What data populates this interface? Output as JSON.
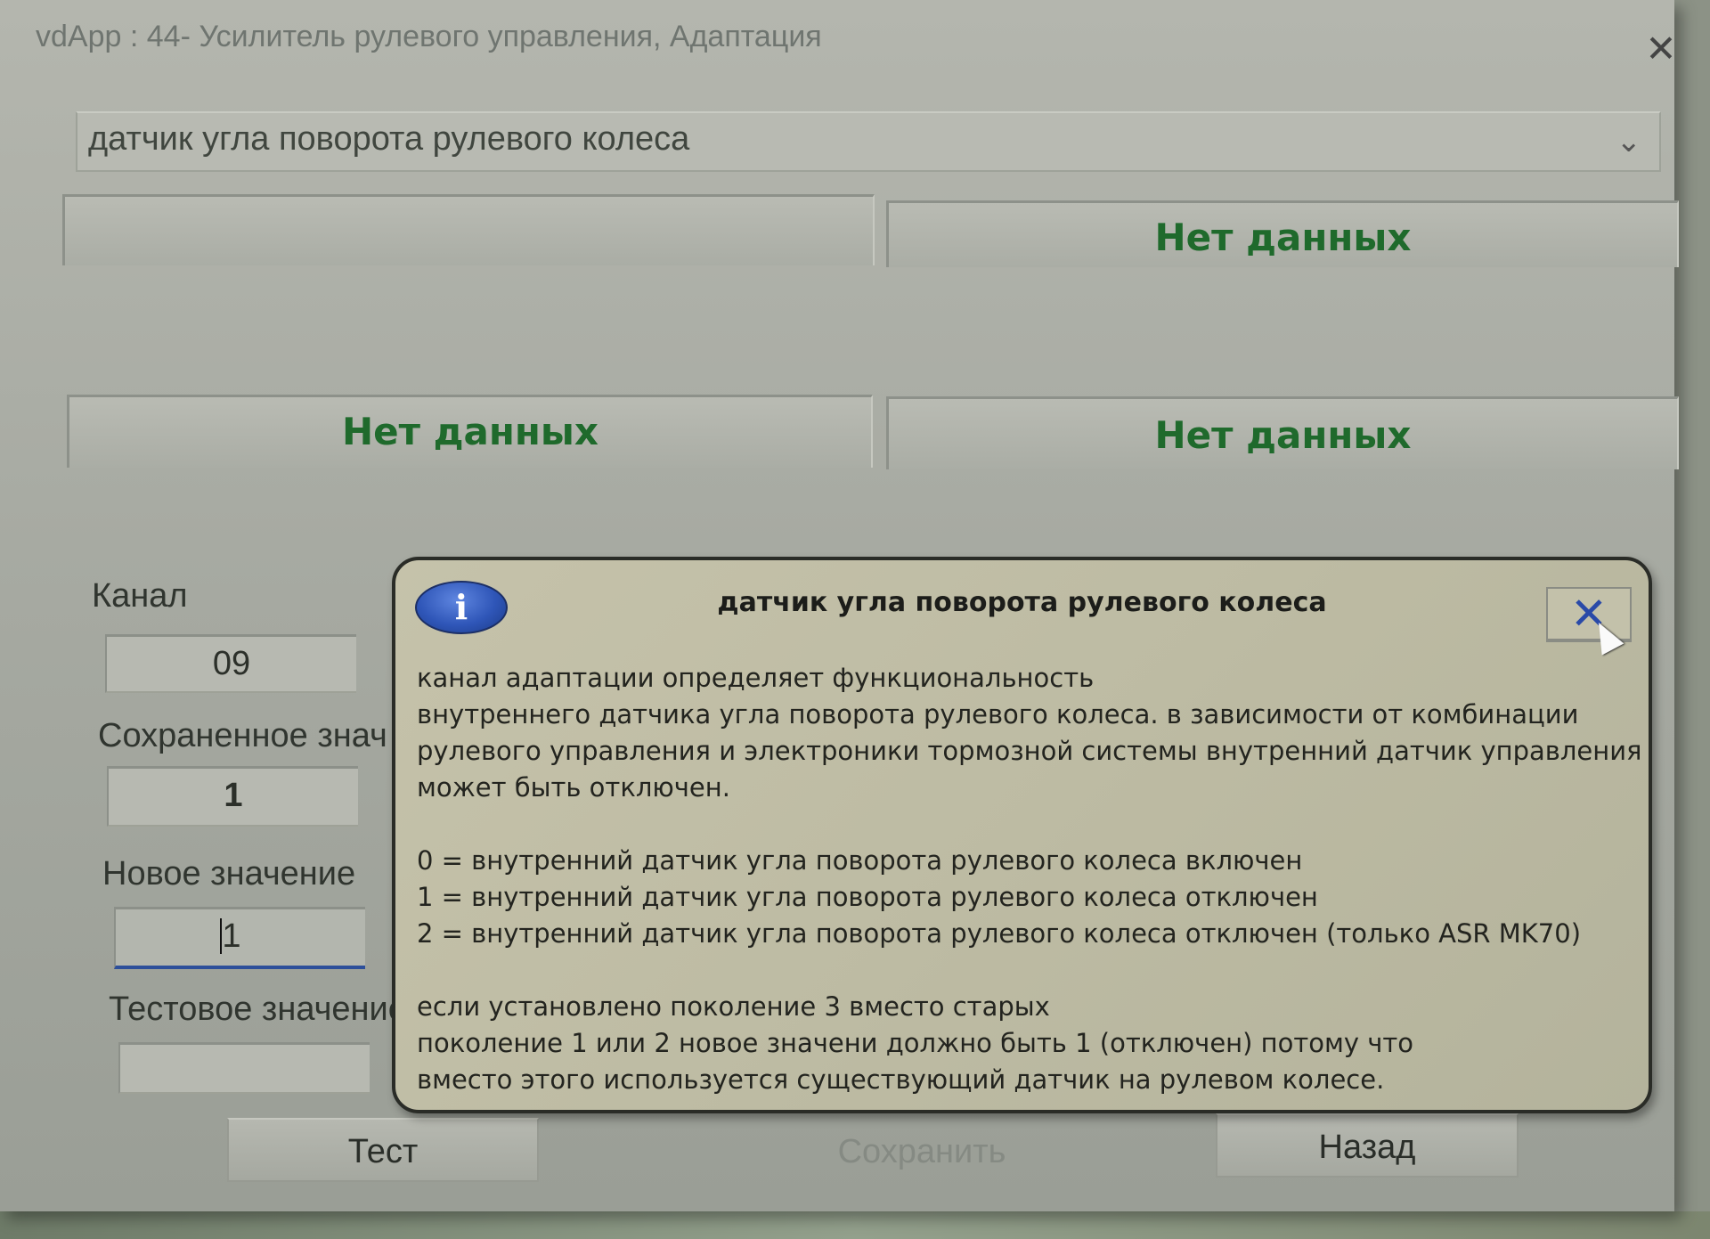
{
  "window": {
    "title": "vdApp : 44- Усилитель рулевого управления, Адаптация",
    "close_glyph": "✕"
  },
  "dropdown": {
    "selected": "датчик угла поворота рулевого колеса",
    "chevron": "⌄"
  },
  "panels": {
    "top_left": "",
    "top_right": "Нет данных",
    "bottom_left": "Нет данных",
    "bottom_right": "Нет данных"
  },
  "fields": {
    "channel_label": "Канал",
    "channel_value": "09",
    "saved_label": "Сохраненное знач",
    "saved_value": "1",
    "new_label": "Новое значение",
    "new_value": "1",
    "test_label": "Тестовое значение",
    "test_value": ""
  },
  "buttons": {
    "test": "Тест",
    "save": "Сохранить",
    "back": "Назад"
  },
  "dialog": {
    "icon_glyph": "i",
    "title": "датчик угла поворота рулевого колеса",
    "close_glyph": "✕",
    "paragraphs": [
      [
        "канал адаптации определяет функциональность",
        "внутреннего датчика угла поворота рулевого колеса. в зависимости от комбинации",
        "рулевого управления и электроники тормозной системы внутренний датчик управления",
        "может быть отключен."
      ],
      [
        "0 = внутренний датчик угла поворота рулевого колеса включен",
        "1 = внутренний датчик угла поворота рулевого колеса отключен",
        "2 = внутренний датчик угла поворота рулевого колеса отключен (только ASR MK70)"
      ],
      [
        "если установлено поколение 3 вместо старых",
        "поколение 1 или 2 новое значени должно быть 1 (отключен) потому что",
        "вместо этого используется существующий датчик на рулевом колесе."
      ]
    ]
  },
  "colors": {
    "data_green": "#1f6a2c",
    "info_blue": "#2f56b8",
    "focus_underline": "#2d4f9a"
  },
  "icons": {
    "window_close": "close-icon",
    "dropdown": "chevron-down-icon",
    "dialog_info": "info-icon",
    "dialog_close": "close-icon",
    "pointer": "cursor-icon"
  }
}
